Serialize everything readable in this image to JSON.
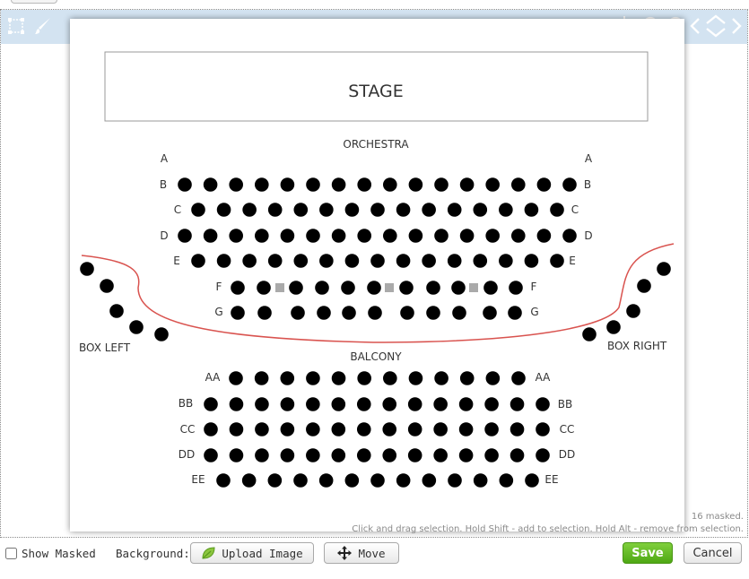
{
  "toolbar": {
    "tools_left": [
      "select-region-icon",
      "brush-icon"
    ],
    "tools_right": [
      "crosshair-icon",
      "zoom-in-icon",
      "zoom-out-icon",
      "pan-left-icon",
      "pan-updown-icon",
      "pan-right-icon"
    ],
    "background_color": "#d3e3f1"
  },
  "chart": {
    "stage": "STAGE",
    "orchestra": "ORCHESTRA",
    "balcony": "BALCONY",
    "box_left": "BOX LEFT",
    "box_right": "BOX RIGHT",
    "orchestra_rows": [
      "A",
      "B",
      "C",
      "D",
      "E",
      "F",
      "G"
    ],
    "balcony_rows": [
      "AA",
      "BB",
      "CC",
      "DD",
      "EE"
    ]
  },
  "status": {
    "masked_count": "16 masked.",
    "hint": "Click and drag selection. Hold Shift - add to selection. Hold Alt - remove from selection."
  },
  "bottom": {
    "show_masked_label": "Show Masked",
    "show_masked_checked": false,
    "background_label": "Background:",
    "upload_label": "Upload Image",
    "move_label": "Move",
    "save_label": "Save",
    "cancel_label": "Cancel"
  },
  "colors": {
    "seat": "#000000",
    "masked_seat": "#aaaaaa",
    "divider_curve": "#d9534f",
    "save_button": "#5cb82a"
  }
}
